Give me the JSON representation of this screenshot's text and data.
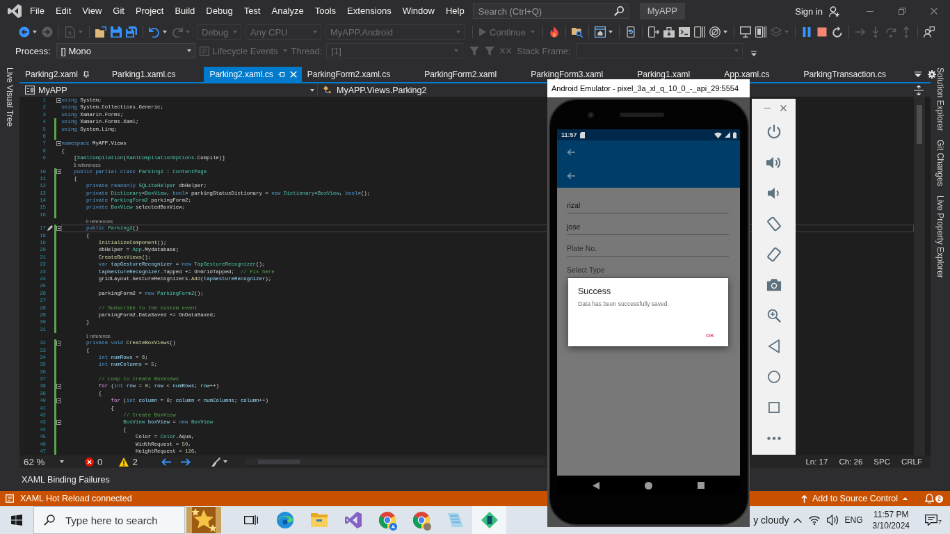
{
  "window": {
    "solution": "MyAPP",
    "search_placeholder": "Search (Ctrl+Q)",
    "sign_in": "Sign in"
  },
  "menu": [
    "File",
    "Edit",
    "View",
    "Git",
    "Project",
    "Build",
    "Debug",
    "Test",
    "Analyze",
    "Tools",
    "Extensions",
    "Window",
    "Help"
  ],
  "toolbar": [
    {
      "kind": "back",
      "disabled": false
    },
    {
      "kind": "forward",
      "disabled": true
    },
    {
      "kind": "new",
      "disabled": true
    },
    {
      "kind": "open",
      "disabled": false
    },
    {
      "kind": "save",
      "disabled": false
    },
    {
      "kind": "saveall",
      "disabled": false
    },
    {
      "kind": "undo",
      "disabled": false
    },
    {
      "kind": "redo",
      "disabled": true
    },
    {
      "kind": "dropdown",
      "text": "Debug",
      "disabled": true
    },
    {
      "kind": "dropdown",
      "text": "Any CPU",
      "disabled": true
    },
    {
      "kind": "dropdown",
      "text": "MyAPP.Android",
      "disabled": true
    },
    {
      "kind": "continue",
      "text": "Continue",
      "disabled": true
    },
    {
      "kind": "hotreload",
      "disabled": false
    },
    {
      "kind": "finder",
      "disabled": false
    },
    {
      "kind": "window",
      "disabled": false
    },
    {
      "kind": "device",
      "disabled": false
    },
    {
      "kind": "deploy",
      "disabled": false
    },
    {
      "kind": "toolbox",
      "disabled": false
    },
    {
      "kind": "console",
      "disabled": false
    },
    {
      "kind": "phone",
      "disabled": false
    },
    {
      "kind": "target",
      "disabled": false
    },
    {
      "kind": "monitor",
      "disabled": false
    },
    {
      "kind": "tablet",
      "disabled": false
    },
    {
      "kind": "layers",
      "disabled": true
    },
    {
      "kind": "pause",
      "disabled": false
    },
    {
      "kind": "stop",
      "disabled": false
    },
    {
      "kind": "restart",
      "disabled": false
    },
    {
      "kind": "step",
      "disabled": true
    },
    {
      "kind": "stepinto",
      "disabled": true
    },
    {
      "kind": "stepover",
      "disabled": true
    },
    {
      "kind": "stepout",
      "disabled": true
    },
    {
      "kind": "feedback",
      "disabled": false
    }
  ],
  "debug_toolbar": [
    {
      "kind": "label",
      "text": "Process:",
      "disabled": false
    },
    {
      "kind": "dropdown",
      "text": "[] Mono",
      "disabled": false
    },
    {
      "kind": "menu",
      "text": "Lifecycle Events",
      "disabled": true
    },
    {
      "kind": "label",
      "text": "Thread:",
      "disabled": true
    },
    {
      "kind": "dropdown",
      "text": "[1]",
      "disabled": true
    },
    {
      "kind": "filter",
      "disabled": true
    },
    {
      "kind": "filter",
      "disabled": true
    },
    {
      "kind": "unflag",
      "disabled": true
    },
    {
      "kind": "label",
      "text": "Stack Frame:",
      "disabled": true
    },
    {
      "kind": "dropdown",
      "disabled": true
    },
    {
      "kind": "overflow",
      "disabled": false
    }
  ],
  "tool_windows": {
    "left": [
      "Live Visual Tree"
    ],
    "right": [
      "Solution Explorer",
      "Git Changes",
      "Live Property Explorer"
    ],
    "bottom": [
      "XAML Binding Failures"
    ]
  },
  "document_tabs": [
    {
      "label": "Parking2.xaml",
      "selected": false,
      "pinned": true
    },
    {
      "label": "Parking1.xaml.cs",
      "selected": false,
      "pinned": false
    },
    {
      "label": "Parking2.xaml.cs",
      "selected": true,
      "pinned": false
    },
    {
      "label": "ParkingForm2.xaml.cs",
      "selected": false,
      "pinned": false
    },
    {
      "label": "ParkingForm2.xaml",
      "selected": false,
      "pinned": false
    },
    {
      "label": "ParkingForm3.xaml",
      "selected": false,
      "pinned": false
    },
    {
      "label": "Parking1.xaml",
      "selected": false,
      "pinned": false
    },
    {
      "label": "App.xaml.cs",
      "selected": false,
      "pinned": false
    },
    {
      "label": "ParkingTransaction.cs",
      "selected": false,
      "pinned": false
    }
  ],
  "navigation_bar": {
    "project": "MyAPP",
    "type": "MyAPP.Views.Parking2"
  },
  "editor": {
    "lines": [
      {
        "n": "1",
        "fold": true,
        "changed": false,
        "current": false,
        "code": [
          {
            "kind": "keyword",
            "text": "using "
          },
          {
            "kind": "plain",
            "text": "System;"
          }
        ]
      },
      {
        "n": "2",
        "fold": false,
        "changed": false,
        "current": false,
        "code": [
          {
            "kind": "keyword",
            "text": "using "
          },
          {
            "kind": "plain",
            "text": "System.Collections.Generic;"
          }
        ]
      },
      {
        "n": "3",
        "fold": false,
        "changed": false,
        "current": false,
        "code": [
          {
            "kind": "keyword",
            "text": "using "
          },
          {
            "kind": "plain",
            "text": "Xamarin.Forms;"
          }
        ]
      },
      {
        "n": "4",
        "fold": false,
        "changed": true,
        "current": false,
        "code": [
          {
            "kind": "keyword",
            "text": "using "
          },
          {
            "kind": "plain",
            "text": "Xamarin.Forms.Xaml;"
          }
        ]
      },
      {
        "n": "5",
        "fold": false,
        "changed": true,
        "current": false,
        "code": [
          {
            "kind": "keyword",
            "text": "using "
          },
          {
            "kind": "plain",
            "text": "System.Linq;"
          }
        ]
      },
      {
        "n": "6",
        "fold": false,
        "changed": true,
        "current": false
      },
      {
        "n": "7",
        "fold": true,
        "changed": false,
        "current": false,
        "code": [
          {
            "kind": "keyword",
            "text": "namespace "
          },
          {
            "kind": "plain",
            "text": "MyAPP.Views"
          }
        ]
      },
      {
        "n": "8",
        "fold": false,
        "changed": false,
        "current": false,
        "code": [
          {
            "kind": "plain",
            "text": "{"
          }
        ]
      },
      {
        "n": "9",
        "fold": false,
        "changed": false,
        "current": false,
        "code": [
          {
            "kind": "plain",
            "text": "    ["
          },
          {
            "kind": "type",
            "text": "XamlCompilation"
          },
          {
            "kind": "plain",
            "text": "("
          },
          {
            "kind": "type",
            "text": "XamlCompilationOptions"
          },
          {
            "kind": "plain",
            "text": ".Compile)]"
          }
        ]
      },
      {
        "n": "10",
        "fold": true,
        "changed": true,
        "current": false,
        "lens": "5 references",
        "code": [
          {
            "kind": "keyword",
            "text": "    public partial class "
          },
          {
            "kind": "type",
            "text": "Parking2"
          },
          {
            "kind": "plain",
            "text": " : "
          },
          {
            "kind": "type",
            "text": "ContentPage"
          }
        ]
      },
      {
        "n": "11",
        "fold": false,
        "changed": true,
        "current": false,
        "code": [
          {
            "kind": "plain",
            "text": "    {"
          }
        ]
      },
      {
        "n": "12",
        "fold": false,
        "changed": true,
        "current": false,
        "code": [
          {
            "kind": "keyword",
            "text": "        private readonly "
          },
          {
            "kind": "type",
            "text": "SQLiteHelper"
          },
          {
            "kind": "plain",
            "text": " dbHelper;"
          }
        ]
      },
      {
        "n": "13",
        "fold": false,
        "changed": true,
        "current": false,
        "code": [
          {
            "kind": "keyword",
            "text": "        private "
          },
          {
            "kind": "type",
            "text": "Dictionary"
          },
          {
            "kind": "plain",
            "text": "<"
          },
          {
            "kind": "type",
            "text": "BoxView"
          },
          {
            "kind": "plain",
            "text": ", "
          },
          {
            "kind": "keyword",
            "text": "bool"
          },
          {
            "kind": "plain",
            "text": "> parkingStatusDictionary = "
          },
          {
            "kind": "keyword",
            "text": "new "
          },
          {
            "kind": "type",
            "text": "Dictionary"
          },
          {
            "kind": "plain",
            "text": "<"
          },
          {
            "kind": "type",
            "text": "BoxView"
          },
          {
            "kind": "plain",
            "text": ", "
          },
          {
            "kind": "keyword",
            "text": "bool"
          },
          {
            "kind": "plain",
            "text": ">();"
          }
        ]
      },
      {
        "n": "14",
        "fold": false,
        "changed": true,
        "current": false,
        "code": [
          {
            "kind": "keyword",
            "text": "        private "
          },
          {
            "kind": "type",
            "text": "ParkingForm2"
          },
          {
            "kind": "plain",
            "text": " parkingForm2;"
          }
        ]
      },
      {
        "n": "15",
        "fold": false,
        "changed": true,
        "current": false,
        "code": [
          {
            "kind": "keyword",
            "text": "        private "
          },
          {
            "kind": "type",
            "text": "BoxView"
          },
          {
            "kind": "plain",
            "text": " selectedBoxView;"
          }
        ]
      },
      {
        "n": "16",
        "fold": false,
        "changed": true,
        "current": false
      },
      {
        "n": "17",
        "fold": true,
        "changed": true,
        "current": true,
        "lens": "0 references",
        "code": [
          {
            "kind": "keyword",
            "text": "        public "
          },
          {
            "kind": "type",
            "text": "Parking2"
          },
          {
            "kind": "plain",
            "text": "()"
          }
        ]
      },
      {
        "n": "18",
        "fold": false,
        "changed": true,
        "current": false,
        "code": [
          {
            "kind": "plain",
            "text": "        {"
          }
        ]
      },
      {
        "n": "19",
        "fold": false,
        "changed": true,
        "current": false,
        "code": [
          {
            "kind": "method",
            "text": "            InitializeComponent"
          },
          {
            "kind": "plain",
            "text": "();"
          }
        ]
      },
      {
        "n": "20",
        "fold": false,
        "changed": true,
        "current": false,
        "code": [
          {
            "kind": "plain",
            "text": "            dbHelper = "
          },
          {
            "kind": "type",
            "text": "App"
          },
          {
            "kind": "plain",
            "text": ".Mydatabase;"
          }
        ]
      },
      {
        "n": "21",
        "fold": false,
        "changed": true,
        "current": false,
        "code": [
          {
            "kind": "method",
            "text": "            CreateBoxViews"
          },
          {
            "kind": "plain",
            "text": "();"
          }
        ]
      },
      {
        "n": "22",
        "fold": false,
        "changed": true,
        "current": false,
        "code": [
          {
            "kind": "keyword",
            "text": "            var "
          },
          {
            "kind": "local",
            "text": "tapGestureRecognizer"
          },
          {
            "kind": "plain",
            "text": " = "
          },
          {
            "kind": "keyword",
            "text": "new "
          },
          {
            "kind": "type",
            "text": "TapGestureRecognizer"
          },
          {
            "kind": "plain",
            "text": "();"
          }
        ]
      },
      {
        "n": "23",
        "fold": false,
        "changed": true,
        "current": false,
        "code": [
          {
            "kind": "local",
            "text": "            tapGestureRecognizer"
          },
          {
            "kind": "plain",
            "text": ".Tapped += OnGridTapped;  "
          },
          {
            "kind": "comment",
            "text": "// Fix here"
          }
        ]
      },
      {
        "n": "24",
        "fold": false,
        "changed": true,
        "current": false,
        "code": [
          {
            "kind": "plain",
            "text": "            gridLayout.GestureRecognizers."
          },
          {
            "kind": "method",
            "text": "Add"
          },
          {
            "kind": "plain",
            "text": "("
          },
          {
            "kind": "local",
            "text": "tapGestureRecognizer"
          },
          {
            "kind": "plain",
            "text": ");"
          }
        ]
      },
      {
        "n": "25",
        "fold": false,
        "changed": true,
        "current": false
      },
      {
        "n": "26",
        "fold": false,
        "changed": true,
        "current": false,
        "code": [
          {
            "kind": "plain",
            "text": "            parkingForm2 = "
          },
          {
            "kind": "keyword",
            "text": "new "
          },
          {
            "kind": "type",
            "text": "ParkingForm2"
          },
          {
            "kind": "plain",
            "text": "();"
          }
        ]
      },
      {
        "n": "27",
        "fold": false,
        "changed": true,
        "current": false
      },
      {
        "n": "28",
        "fold": false,
        "changed": true,
        "current": false,
        "code": [
          {
            "kind": "comment",
            "text": "            // Subscribe to the custom event"
          }
        ]
      },
      {
        "n": "29",
        "fold": false,
        "changed": true,
        "current": false,
        "code": [
          {
            "kind": "plain",
            "text": "            parkingForm2.DataSaved += OnDataSaved;"
          }
        ]
      },
      {
        "n": "30",
        "fold": false,
        "changed": true,
        "current": false,
        "code": [
          {
            "kind": "plain",
            "text": "        }"
          }
        ]
      },
      {
        "n": "31",
        "fold": false,
        "changed": true,
        "current": false
      },
      {
        "n": "32",
        "fold": true,
        "changed": true,
        "current": false,
        "lens": "1 reference",
        "code": [
          {
            "kind": "keyword",
            "text": "        private void "
          },
          {
            "kind": "method",
            "text": "CreateBoxViews"
          },
          {
            "kind": "plain",
            "text": "()"
          }
        ]
      },
      {
        "n": "33",
        "fold": false,
        "changed": true,
        "current": false,
        "code": [
          {
            "kind": "plain",
            "text": "        {"
          }
        ]
      },
      {
        "n": "34",
        "fold": false,
        "changed": true,
        "current": false,
        "code": [
          {
            "kind": "keyword",
            "text": "            int "
          },
          {
            "kind": "local",
            "text": "numRows"
          },
          {
            "kind": "plain",
            "text": " = "
          },
          {
            "kind": "number",
            "text": "6"
          },
          {
            "kind": "plain",
            "text": ";"
          }
        ]
      },
      {
        "n": "35",
        "fold": false,
        "changed": true,
        "current": false,
        "code": [
          {
            "kind": "keyword",
            "text": "            int "
          },
          {
            "kind": "local",
            "text": "numColumns"
          },
          {
            "kind": "plain",
            "text": " = "
          },
          {
            "kind": "number",
            "text": "5"
          },
          {
            "kind": "plain",
            "text": ";"
          }
        ]
      },
      {
        "n": "36",
        "fold": false,
        "changed": true,
        "current": false
      },
      {
        "n": "37",
        "fold": false,
        "changed": true,
        "current": false,
        "code": [
          {
            "kind": "comment",
            "text": "            // Loop to create BoxViews"
          }
        ]
      },
      {
        "n": "38",
        "fold": true,
        "changed": true,
        "current": false,
        "code": [
          {
            "kind": "control",
            "text": "            for "
          },
          {
            "kind": "plain",
            "text": "("
          },
          {
            "kind": "keyword",
            "text": "int "
          },
          {
            "kind": "local",
            "text": "row"
          },
          {
            "kind": "plain",
            "text": " = "
          },
          {
            "kind": "number",
            "text": "0"
          },
          {
            "kind": "plain",
            "text": "; "
          },
          {
            "kind": "local",
            "text": "row"
          },
          {
            "kind": "plain",
            "text": " < "
          },
          {
            "kind": "local",
            "text": "numRows"
          },
          {
            "kind": "plain",
            "text": "; "
          },
          {
            "kind": "local",
            "text": "row"
          },
          {
            "kind": "plain",
            "text": "++)"
          }
        ]
      },
      {
        "n": "39",
        "fold": false,
        "changed": true,
        "current": false,
        "code": [
          {
            "kind": "plain",
            "text": "            {"
          }
        ]
      },
      {
        "n": "40",
        "fold": true,
        "changed": true,
        "current": false,
        "code": [
          {
            "kind": "control",
            "text": "                for "
          },
          {
            "kind": "plain",
            "text": "("
          },
          {
            "kind": "keyword",
            "text": "int "
          },
          {
            "kind": "local",
            "text": "column"
          },
          {
            "kind": "plain",
            "text": " = "
          },
          {
            "kind": "number",
            "text": "0"
          },
          {
            "kind": "plain",
            "text": "; "
          },
          {
            "kind": "local",
            "text": "column"
          },
          {
            "kind": "plain",
            "text": " < "
          },
          {
            "kind": "local",
            "text": "numColumns"
          },
          {
            "kind": "plain",
            "text": "; "
          },
          {
            "kind": "local",
            "text": "column"
          },
          {
            "kind": "plain",
            "text": "++)"
          }
        ]
      },
      {
        "n": "41",
        "fold": false,
        "changed": true,
        "current": false,
        "code": [
          {
            "kind": "plain",
            "text": "                {"
          }
        ]
      },
      {
        "n": "42",
        "fold": false,
        "changed": true,
        "current": false,
        "code": [
          {
            "kind": "comment",
            "text": "                    // Create BoxView"
          }
        ]
      },
      {
        "n": "43",
        "fold": true,
        "changed": true,
        "current": false,
        "code": [
          {
            "kind": "type",
            "text": "                    BoxView "
          },
          {
            "kind": "local",
            "text": "boxView"
          },
          {
            "kind": "plain",
            "text": " = "
          },
          {
            "kind": "keyword",
            "text": "new "
          },
          {
            "kind": "type",
            "text": "BoxView"
          }
        ]
      },
      {
        "n": "44",
        "fold": false,
        "changed": true,
        "current": false,
        "code": [
          {
            "kind": "plain",
            "text": "                    {"
          }
        ]
      },
      {
        "n": "45",
        "fold": false,
        "changed": true,
        "current": false,
        "code": [
          {
            "kind": "plain",
            "text": "                        Color = "
          },
          {
            "kind": "type",
            "text": "Color"
          },
          {
            "kind": "plain",
            "text": ".Aqua,"
          }
        ]
      },
      {
        "n": "46",
        "fold": false,
        "changed": true,
        "current": false,
        "code": [
          {
            "kind": "plain",
            "text": "                        WidthRequest = "
          },
          {
            "kind": "number",
            "text": "50"
          },
          {
            "kind": "plain",
            "text": ","
          }
        ]
      },
      {
        "n": "47",
        "fold": false,
        "changed": true,
        "current": false,
        "code": [
          {
            "kind": "plain",
            "text": "                        HeightRequest = "
          },
          {
            "kind": "number",
            "text": "126"
          },
          {
            "kind": "plain",
            "text": ","
          }
        ]
      }
    ]
  },
  "editor_status": {
    "zoom": "62 %",
    "errors": "0",
    "warnings": "2",
    "line": "Ln: 17",
    "column": "Ch: 26",
    "whitespace": "SPC",
    "line_ending": "CRLF"
  },
  "status_bar": {
    "message": "XAML Hot Reload connected",
    "source_control": "Add to Source Control",
    "notifications": "2"
  },
  "emulator": {
    "title": "Android Emulator - pixel_3a_xl_q_10_0_-_api_29:5554",
    "time": "11:57",
    "fields": [
      {
        "value": "rizal"
      },
      {
        "value": "jose"
      },
      {
        "placeholder": "Plate No."
      },
      {
        "placeholder": "Select Type"
      }
    ],
    "dialog": {
      "title": "Success",
      "message": "Data has been successfully saved.",
      "button": "OK"
    }
  },
  "taskbar": {
    "search_placeholder": "Type here to search",
    "apps": [
      {
        "kind": "taskview",
        "selected": false
      },
      {
        "kind": "edge",
        "selected": false
      },
      {
        "kind": "explorer",
        "selected": false
      },
      {
        "kind": "studio",
        "selected": false
      },
      {
        "kind": "browser",
        "selected": false,
        "badge": "A",
        "avatar": false
      },
      {
        "kind": "browser",
        "selected": false,
        "avatar": true
      },
      {
        "kind": "notes",
        "selected": false
      },
      {
        "kind": "emulator",
        "selected": true
      }
    ],
    "weather": "y cloudy",
    "language": "ENG",
    "time": "11:57 PM",
    "date": "3/10/2024",
    "notifications": "7"
  }
}
